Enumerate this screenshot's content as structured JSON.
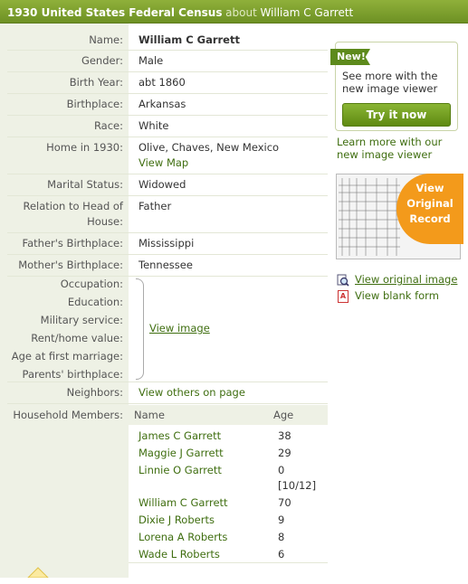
{
  "header": {
    "collection": "1930 United States Federal Census",
    "about": "about",
    "person": "William C Garrett"
  },
  "fields": {
    "name": {
      "label": "Name:",
      "value": "William C Garrett"
    },
    "gender": {
      "label": "Gender:",
      "value": "Male"
    },
    "birth_year": {
      "label": "Birth Year:",
      "value": "abt 1860"
    },
    "birthplace": {
      "label": "Birthplace:",
      "value": "Arkansas"
    },
    "race": {
      "label": "Race:",
      "value": "White"
    },
    "home": {
      "label": "Home in 1930:",
      "value": "Olive, Chaves, New Mexico",
      "link": "View Map"
    },
    "marital": {
      "label": "Marital Status:",
      "value": "Widowed"
    },
    "relation": {
      "label_line1": "Relation to Head of",
      "label_line2": "House:",
      "value": "Father"
    },
    "father_bp": {
      "label": "Father's Birthplace:",
      "value": "Mississippi"
    },
    "mother_bp": {
      "label": "Mother's Birthplace:",
      "value": "Tennessee"
    },
    "occupation": {
      "label": "Occupation:"
    },
    "education": {
      "label": "Education:"
    },
    "military": {
      "label": "Military service:"
    },
    "rent": {
      "label": "Rent/home value:"
    },
    "age_marriage": {
      "label": "Age at first marriage:"
    },
    "parents_bp": {
      "label": "Parents' birthplace:"
    },
    "view_image": "View image",
    "neighbors": {
      "label": "Neighbors:",
      "link": "View others on page"
    },
    "household": {
      "label": "Household Members:",
      "col_name": "Name",
      "col_age": "Age"
    }
  },
  "household_members": [
    {
      "name": "James C Garrett",
      "age": "38"
    },
    {
      "name": "Maggie J Garrett",
      "age": "29"
    },
    {
      "name": "Linnie O Garrett",
      "age": "0",
      "age2": "[10/12]"
    },
    {
      "name": "William C Garrett",
      "age": "70"
    },
    {
      "name": "Dixie J Roberts",
      "age": "9"
    },
    {
      "name": "Lorena A Roberts",
      "age": "8"
    },
    {
      "name": "Wade L Roberts",
      "age": "6"
    }
  ],
  "sidebar": {
    "new_tag": "New!",
    "promo_line1": "See more with the",
    "promo_line2": "new image viewer",
    "try_button": "Try it now",
    "learn_line1": "Learn more with our",
    "learn_line2": "new image viewer",
    "badge_line1": "View",
    "badge_line2": "Original",
    "badge_line3": "Record",
    "view_original": "View original image",
    "view_blank": "View blank form"
  }
}
